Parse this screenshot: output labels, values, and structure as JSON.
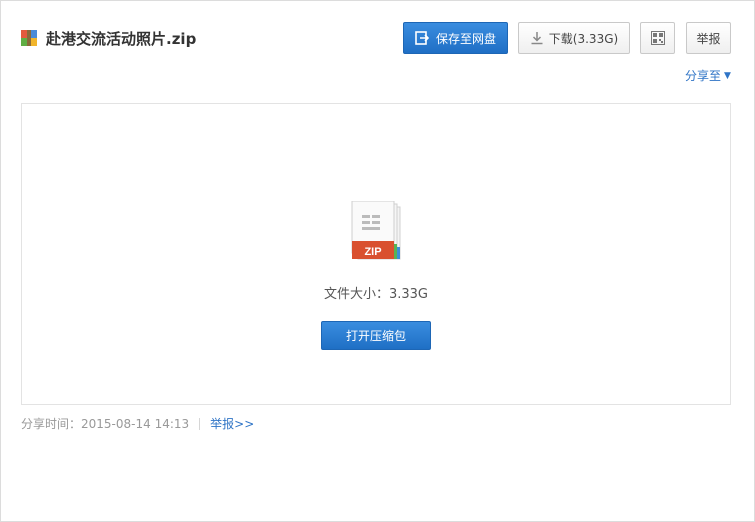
{
  "file": {
    "name": "赴港交流活动照片.zip",
    "icon": "zip-archive-icon"
  },
  "toolbar": {
    "save_label": "保存至网盘",
    "download_label": "下载(3.33G)",
    "qr_icon": "qr-code-icon",
    "report_label": "举报",
    "share_label": "分享至",
    "accent_color": "#2f7ed8"
  },
  "preview": {
    "file_type_label": "ZIP",
    "size_label": "文件大小：",
    "size_value": "3.33G",
    "open_label": "打开压缩包"
  },
  "meta": {
    "share_time_label": "分享时间：",
    "share_time_value": "2015-08-14 14:13",
    "report_link": "举报>>"
  }
}
